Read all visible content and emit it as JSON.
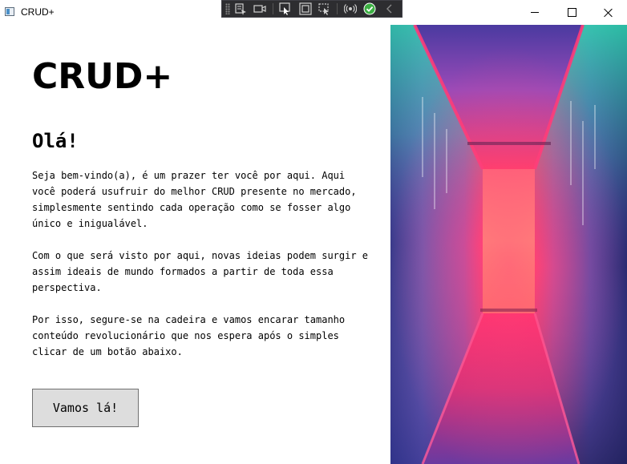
{
  "window": {
    "title": "CRUD+",
    "controls": {
      "minimize": "minimize",
      "maximize": "maximize",
      "close": "close"
    }
  },
  "debug_toolbar": {
    "icons": [
      "select-element-icon",
      "video-icon",
      "pointer-select-icon",
      "display-layout-icon",
      "track-focus-icon",
      "hot-reload-icon",
      "status-ok-icon",
      "collapse-chevron-icon"
    ]
  },
  "main": {
    "heading": "CRUD+",
    "greeting": "Olá!",
    "paragraphs": [
      "Seja bem-vindo(a), é um prazer ter você por aqui. Aqui\nvocê poderá usufruir do melhor CRUD presente no mercado,\nsimplesmente sentindo cada operação como se fosser algo\núnico e inigualável.",
      "Com o que será visto por aqui, novas ideias podem surgir e\nassim ideais de mundo formados a partir de toda essa\nperspectiva.",
      "Por isso, segure-se na cadeira e vamos encarar tamanho\nconteúdo revolucionário que nos espera após o simples\nclicar de um botão abaixo."
    ],
    "cta_label": "Vamos lá!"
  },
  "colors": {
    "background": "#ffffff",
    "button_bg": "#dddddd",
    "button_border": "#707070",
    "toolbar_bg": "#2d2d30",
    "neon_pink": "#ff2a6d",
    "neon_teal": "#2de0b0",
    "neon_purple": "#5b3c9e"
  }
}
